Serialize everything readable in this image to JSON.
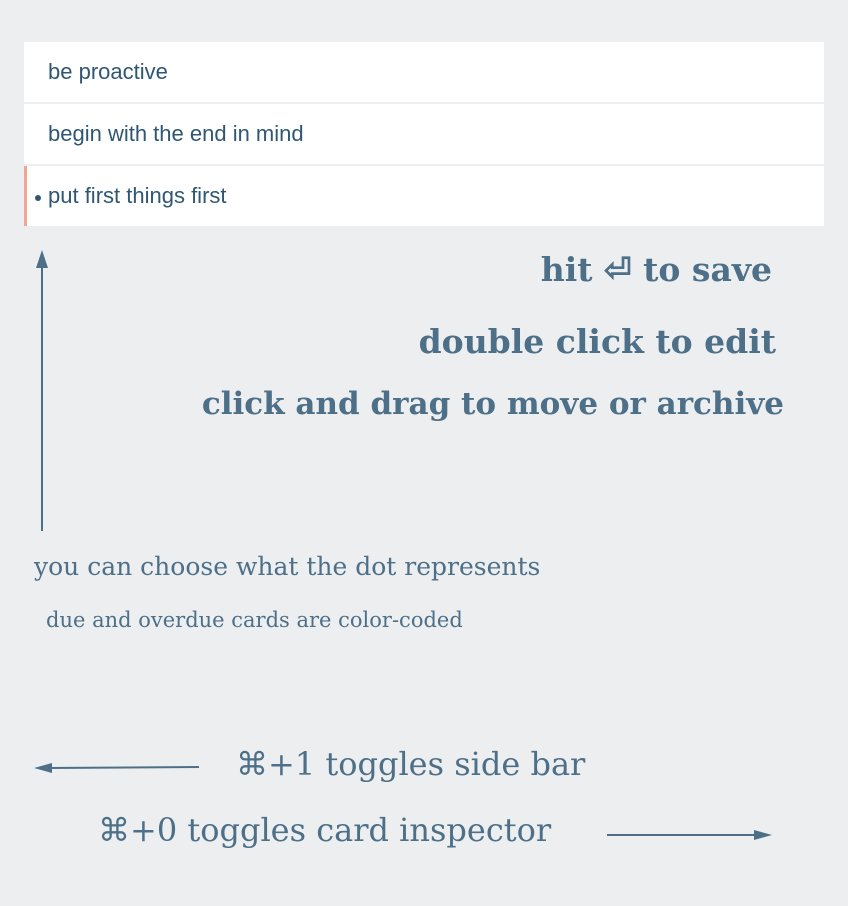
{
  "cards": [
    {
      "label": "be proactive",
      "has_dot": false
    },
    {
      "label": "begin with the end in mind",
      "has_dot": false
    },
    {
      "label": "put first things first",
      "has_dot": true
    }
  ],
  "hints": {
    "save": "hit ⏎ to save",
    "edit": "double click to edit",
    "move": "click and drag to move or archive",
    "dot": "you can choose what the dot represents",
    "due": "due and overdue cards are color-coded",
    "sidebar": "⌘+1 toggles side bar",
    "inspector": "⌘+0 toggles card inspector"
  },
  "colors": {
    "background": "#eceef0",
    "card": "#ffffff",
    "card_text": "#2f5773",
    "hint_text": "#4d7088",
    "flag_accent": "#f1a690"
  },
  "icons": [
    "return-key-icon",
    "command-key-icon",
    "arrow-up-icon",
    "arrow-left-icon",
    "arrow-right-icon"
  ]
}
